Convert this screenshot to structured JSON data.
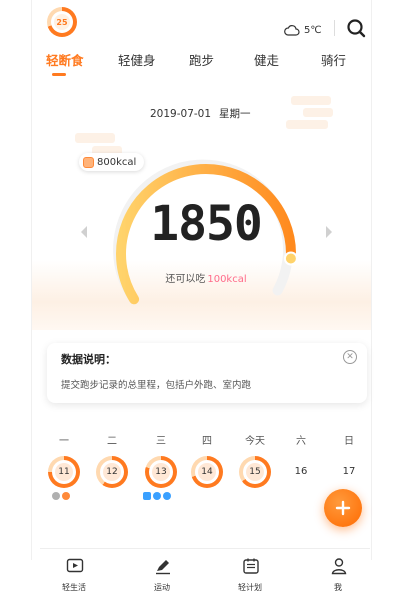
{
  "header": {
    "avatar_badge": "25",
    "weather_temp": "5℃",
    "icons": [
      "cloud-icon",
      "search-icon"
    ]
  },
  "tabs": [
    {
      "label": "轻断食",
      "active": true
    },
    {
      "label": "轻健身",
      "active": false
    },
    {
      "label": "跑步",
      "active": false
    },
    {
      "label": "健走",
      "active": false
    },
    {
      "label": "骑行",
      "active": false
    }
  ],
  "summary": {
    "date": "2019-07-01",
    "weekday": "星期一",
    "target_badge": "800kcal",
    "calories": "1850",
    "remain_label": "还可以吃",
    "remain_value": "100kcal"
  },
  "note": {
    "title": "数据说明：",
    "text": "提交跑步记录的总里程，包括户外跑、室内跑"
  },
  "week": {
    "days": [
      {
        "label": "一",
        "date": "11",
        "ring": true
      },
      {
        "label": "二",
        "date": "12",
        "ring": true
      },
      {
        "label": "三",
        "date": "13",
        "ring": true
      },
      {
        "label": "四",
        "date": "14",
        "ring": true
      },
      {
        "label": "今天",
        "date": "15",
        "ring": true
      },
      {
        "label": "六",
        "date": "16",
        "ring": false
      },
      {
        "label": "日",
        "date": "17",
        "ring": false
      }
    ]
  },
  "bottom_nav": [
    {
      "label": "轻生活",
      "icon": "video-icon"
    },
    {
      "label": "运动",
      "icon": "pen-icon"
    },
    {
      "label": "轻计划",
      "icon": "calendar-icon"
    },
    {
      "label": "我",
      "icon": "user-icon"
    }
  ],
  "colors": {
    "accent": "#ff7a20",
    "highlight": "#ff6b8a",
    "ring_start": "#ffd36b",
    "ring_end": "#ff8a1e"
  }
}
